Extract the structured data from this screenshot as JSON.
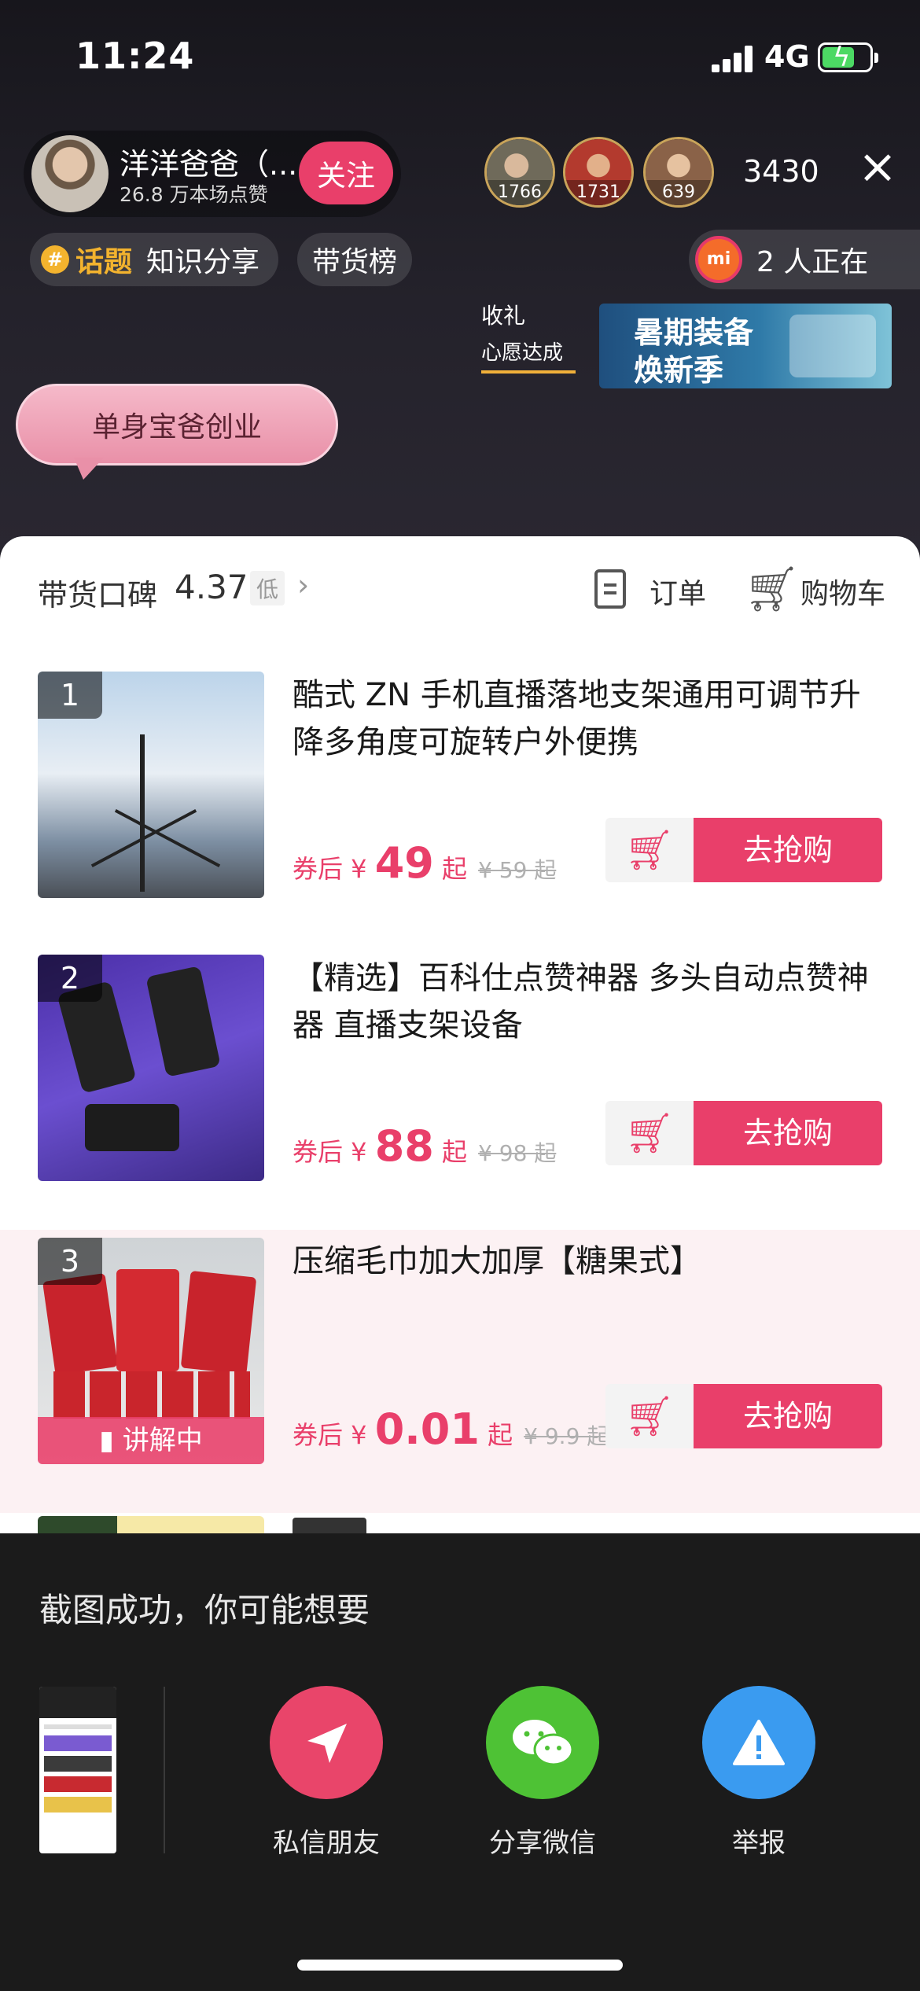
{
  "status_bar": {
    "time": "11:24",
    "network": "4G"
  },
  "host": {
    "name": "洋洋爸爸（...",
    "likes": "26.8 万本场点赞",
    "follow_label": "关注"
  },
  "viewers": [
    {
      "count": "1766",
      "color": "#6f6a5a"
    },
    {
      "count": "1731",
      "color": "#b33a2e"
    },
    {
      "count": "639",
      "color": "#8a6248"
    }
  ],
  "viewer_total": "3430",
  "topic": {
    "icon": "#",
    "tag": "话题",
    "text": "知识分享"
  },
  "rank_label": "带货榜",
  "online": {
    "logo": "mi",
    "text": "2 人正在"
  },
  "wish": {
    "top": "收礼",
    "bottom": "心愿达成"
  },
  "promo_banner": {
    "line1": "暑期装备",
    "line2": "焕新季"
  },
  "bubble_text": "单身宝爸创业",
  "sheet": {
    "reputation_label": "带货口碑",
    "reputation_score": "4.37",
    "reputation_level": "低",
    "orders_label": "订单",
    "cart_label": "购物车"
  },
  "products": [
    {
      "index": "1",
      "title": "酷式 ZN 手机直播落地支架通用可调节升降多角度可旋转户外便携",
      "price_prefix": "券后 ¥ ",
      "price": "49",
      "price_suffix": " 起",
      "old_price": "¥ 59 起",
      "buy_label": "去抢购",
      "live": false,
      "live_label": ""
    },
    {
      "index": "2",
      "title": "【精选】百科仕点赞神器 多头自动点赞神器 直播支架设备",
      "price_prefix": "券后 ¥ ",
      "price": "88",
      "price_suffix": " 起",
      "old_price": "¥ 98 起",
      "buy_label": "去抢购",
      "live": false,
      "live_label": ""
    },
    {
      "index": "3",
      "title": "压缩毛巾加大加厚【糖果式】",
      "price_prefix": "券后 ¥ ",
      "price": "0.01",
      "price_suffix": " 起",
      "old_price": "¥ 9.9 起",
      "buy_label": "去抢购",
      "live": true,
      "live_label": "讲解中"
    }
  ],
  "share": {
    "title": "截图成功，你可能想要",
    "actions": [
      {
        "label": "私信朋友",
        "icon": "send-icon",
        "color": "#e9456a"
      },
      {
        "label": "分享微信",
        "icon": "wechat-icon",
        "color": "#4ec235"
      },
      {
        "label": "举报",
        "icon": "warning-icon",
        "color": "#3a9bf0"
      }
    ]
  },
  "colors": {
    "accent": "#e93f6a",
    "gold": "#f3b32e"
  }
}
